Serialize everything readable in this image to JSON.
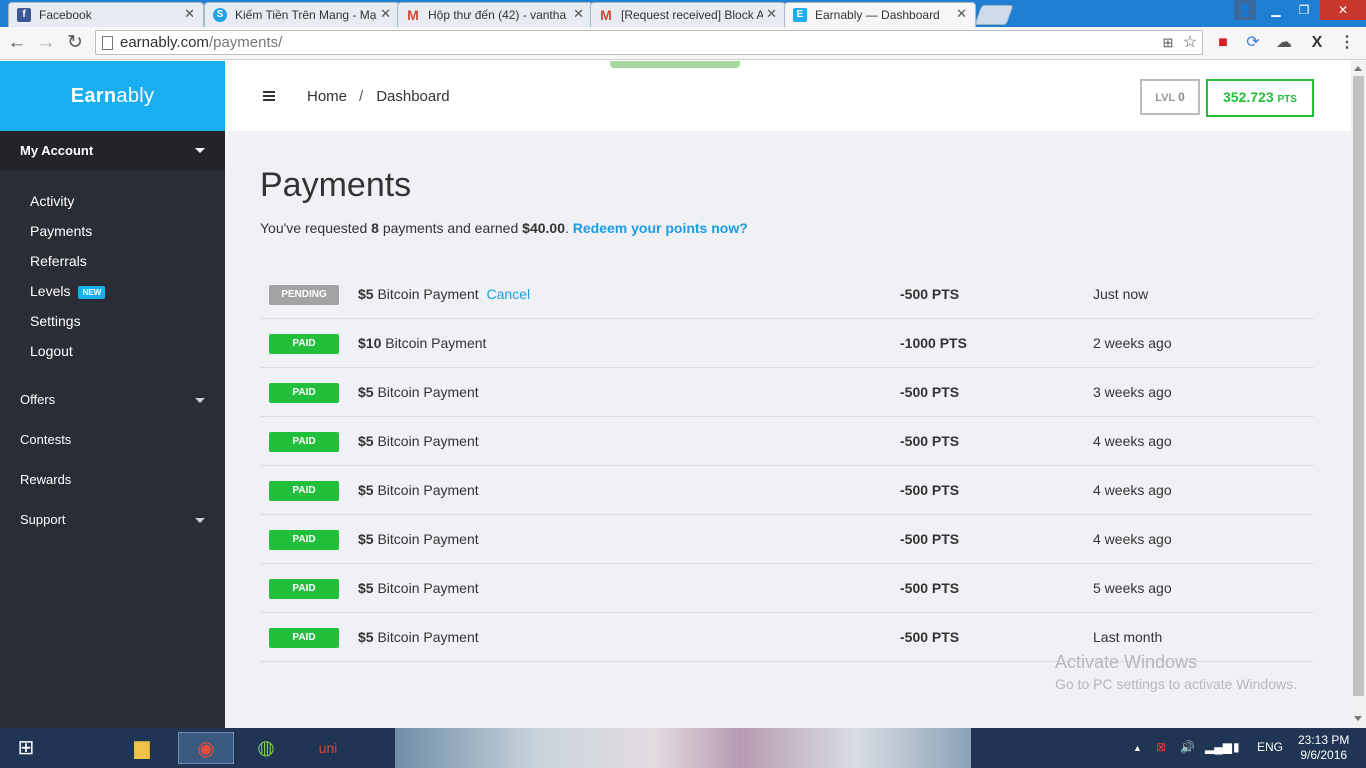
{
  "browser": {
    "tabs": [
      {
        "title": "Facebook",
        "icon": "facebook-icon",
        "color": "#3b5998",
        "glyph": "f"
      },
      {
        "title": "Kiếm Tiền Trên Mang - Mạ",
        "icon": "skype-like-icon",
        "color": "#1ea1e6",
        "glyph": "S"
      },
      {
        "title": "Hộp thư đến (42) - vantha",
        "icon": "gmail-icon",
        "color": "#d14836",
        "glyph": "M"
      },
      {
        "title": "[Request received] Block A",
        "icon": "gmail-icon",
        "color": "#d14836",
        "glyph": "M"
      },
      {
        "title": "Earnably — Dashboard",
        "icon": "earnably-icon",
        "color": "#19aef0",
        "glyph": "E"
      }
    ],
    "url_domain": "earnably.com",
    "url_path": "/payments/"
  },
  "sidebar": {
    "brand_bold": "Earn",
    "brand_rest": "ably",
    "account_header": "My Account",
    "account_items": [
      {
        "label": "Activity"
      },
      {
        "label": "Payments"
      },
      {
        "label": "Referrals"
      },
      {
        "label": "Levels",
        "badge": "NEW"
      },
      {
        "label": "Settings"
      },
      {
        "label": "Logout"
      }
    ],
    "nav": [
      {
        "label": "Offers"
      },
      {
        "label": "Contests"
      },
      {
        "label": "Rewards"
      },
      {
        "label": "Support"
      }
    ]
  },
  "topbar": {
    "crumb_home": "Home",
    "crumb_sep": "/",
    "crumb_current": "Dashboard",
    "level_label": "LVL",
    "level_value": "0",
    "points_value": "352.723",
    "points_unit": "PTS"
  },
  "page": {
    "title": "Payments",
    "summary_pre": "You've requested ",
    "summary_count": "8",
    "summary_mid": " payments and earned ",
    "summary_amount": "$40.00",
    "summary_post": ". ",
    "redeem_link": "Redeem your points now?"
  },
  "payments": [
    {
      "status": "PENDING",
      "amount": "$5",
      "desc": "Bitcoin Payment",
      "action": "Cancel",
      "points": "-500 PTS",
      "when": "Just now"
    },
    {
      "status": "PAID",
      "amount": "$10",
      "desc": "Bitcoin Payment",
      "points": "-1000 PTS",
      "when": "2 weeks ago"
    },
    {
      "status": "PAID",
      "amount": "$5",
      "desc": "Bitcoin Payment",
      "points": "-500 PTS",
      "when": "3 weeks ago"
    },
    {
      "status": "PAID",
      "amount": "$5",
      "desc": "Bitcoin Payment",
      "points": "-500 PTS",
      "when": "4 weeks ago"
    },
    {
      "status": "PAID",
      "amount": "$5",
      "desc": "Bitcoin Payment",
      "points": "-500 PTS",
      "when": "4 weeks ago"
    },
    {
      "status": "PAID",
      "amount": "$5",
      "desc": "Bitcoin Payment",
      "points": "-500 PTS",
      "when": "4 weeks ago"
    },
    {
      "status": "PAID",
      "amount": "$5",
      "desc": "Bitcoin Payment",
      "points": "-500 PTS",
      "when": "5 weeks ago"
    },
    {
      "status": "PAID",
      "amount": "$5",
      "desc": "Bitcoin Payment",
      "points": "-500 PTS",
      "when": "Last month"
    }
  ],
  "watermark": {
    "line1": "Activate Windows",
    "line2": "Go to PC settings to activate Windows."
  },
  "taskbar": {
    "lang": "ENG",
    "time": "23:13 PM",
    "date": "9/6/2016"
  },
  "colors": {
    "brand": "#19aef0",
    "paid": "#21bf3c",
    "pending": "#a3a3a3",
    "link": "#1b9de3",
    "sidebar": "#2b2d36"
  }
}
